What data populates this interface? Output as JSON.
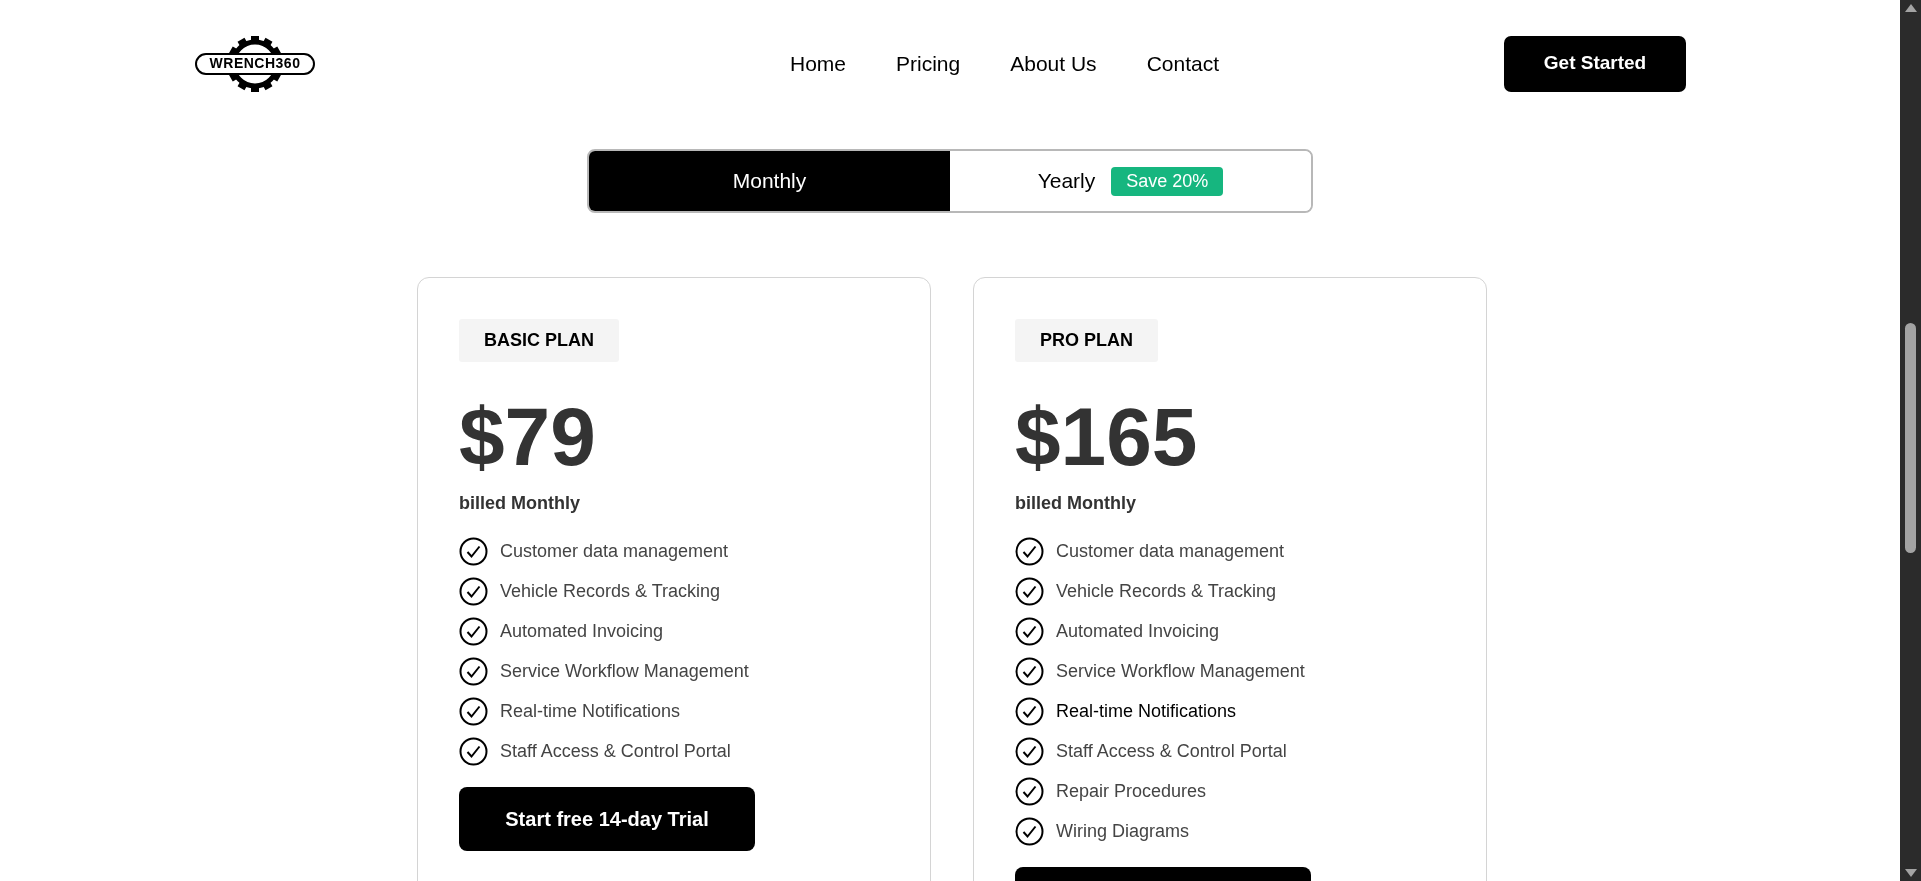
{
  "nav": {
    "logo": "WRENCH360",
    "links": [
      "Home",
      "Pricing",
      "About Us",
      "Contact"
    ],
    "cta": "Get Started"
  },
  "billing_toggle": {
    "options": [
      {
        "label": "Monthly",
        "selected": true
      },
      {
        "label": "Yearly",
        "selected": false,
        "badge": "Save 20%"
      }
    ]
  },
  "plans": [
    {
      "tag": "BASIC PLAN",
      "price": "$79",
      "billing": "billed Monthly",
      "features": [
        {
          "text": "Customer data management",
          "highlighted": false
        },
        {
          "text": "Vehicle Records & Tracking",
          "highlighted": false
        },
        {
          "text": "Automated Invoicing",
          "highlighted": false
        },
        {
          "text": "Service Workflow Management",
          "highlighted": false
        },
        {
          "text": "Real-time Notifications",
          "highlighted": false
        },
        {
          "text": "Staff Access & Control Portal",
          "highlighted": false
        }
      ],
      "cta": {
        "label": "Start free 14-day Trial"
      }
    },
    {
      "tag": "PRO PLAN",
      "price": "$165",
      "billing": "billed Monthly",
      "features": [
        {
          "text": "Customer data management",
          "highlighted": false
        },
        {
          "text": "Vehicle Records & Tracking",
          "highlighted": false
        },
        {
          "text": "Automated Invoicing",
          "highlighted": false
        },
        {
          "text": "Service Workflow Management",
          "highlighted": false
        },
        {
          "text": "Real-time Notifications",
          "highlighted": true
        },
        {
          "text": "Staff Access & Control Portal",
          "highlighted": false
        },
        {
          "text": "Repair Procedures",
          "highlighted": false
        },
        {
          "text": "Wiring Diagrams",
          "highlighted": false
        }
      ],
      "cta": {
        "cut_off": true
      }
    }
  ]
}
